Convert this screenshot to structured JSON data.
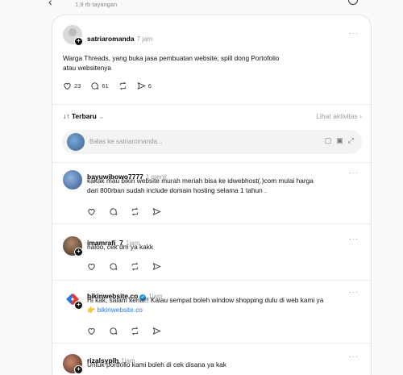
{
  "topbar": {
    "views": "1,9 rb tayangan"
  },
  "post": {
    "username": "satriaromanda",
    "time": "7 jam",
    "text_line1": "Warga Threads, yang buka jasa pembuatan website, spill dong Portofolio",
    "text_line2": "atau websitenya",
    "likes": "23",
    "comments": "61",
    "shares": "6"
  },
  "sort": {
    "label": "↓↑ Terbaru",
    "activity": "Lihat aktivitas"
  },
  "reply": {
    "placeholder": "Balas ke satriaromanda..."
  },
  "comments": [
    {
      "username": "bayuwibowo7777",
      "time": "1 menit",
      "line1": "kakak mau bikin website murah meriah bisa ke idwebhost(.)com mulai harga",
      "line2": "dari 800rban sudah include domain hosting selama 1 tahun ."
    },
    {
      "username": "imamrafi_7",
      "time": "1jam",
      "line1": "haloo, cek dm ya kakk"
    },
    {
      "username": "bikinwebsite.co",
      "time": "1jam",
      "line1": "Hi kak, salam kenal!! Kalau sempat boleh window shopping dulu di web kami ya",
      "link": "bikinwebsite.co"
    },
    {
      "username": "rizalsyplh",
      "time": "1jam",
      "line1": "Untuk portfolio kami boleh di cek disana ya kak"
    }
  ]
}
